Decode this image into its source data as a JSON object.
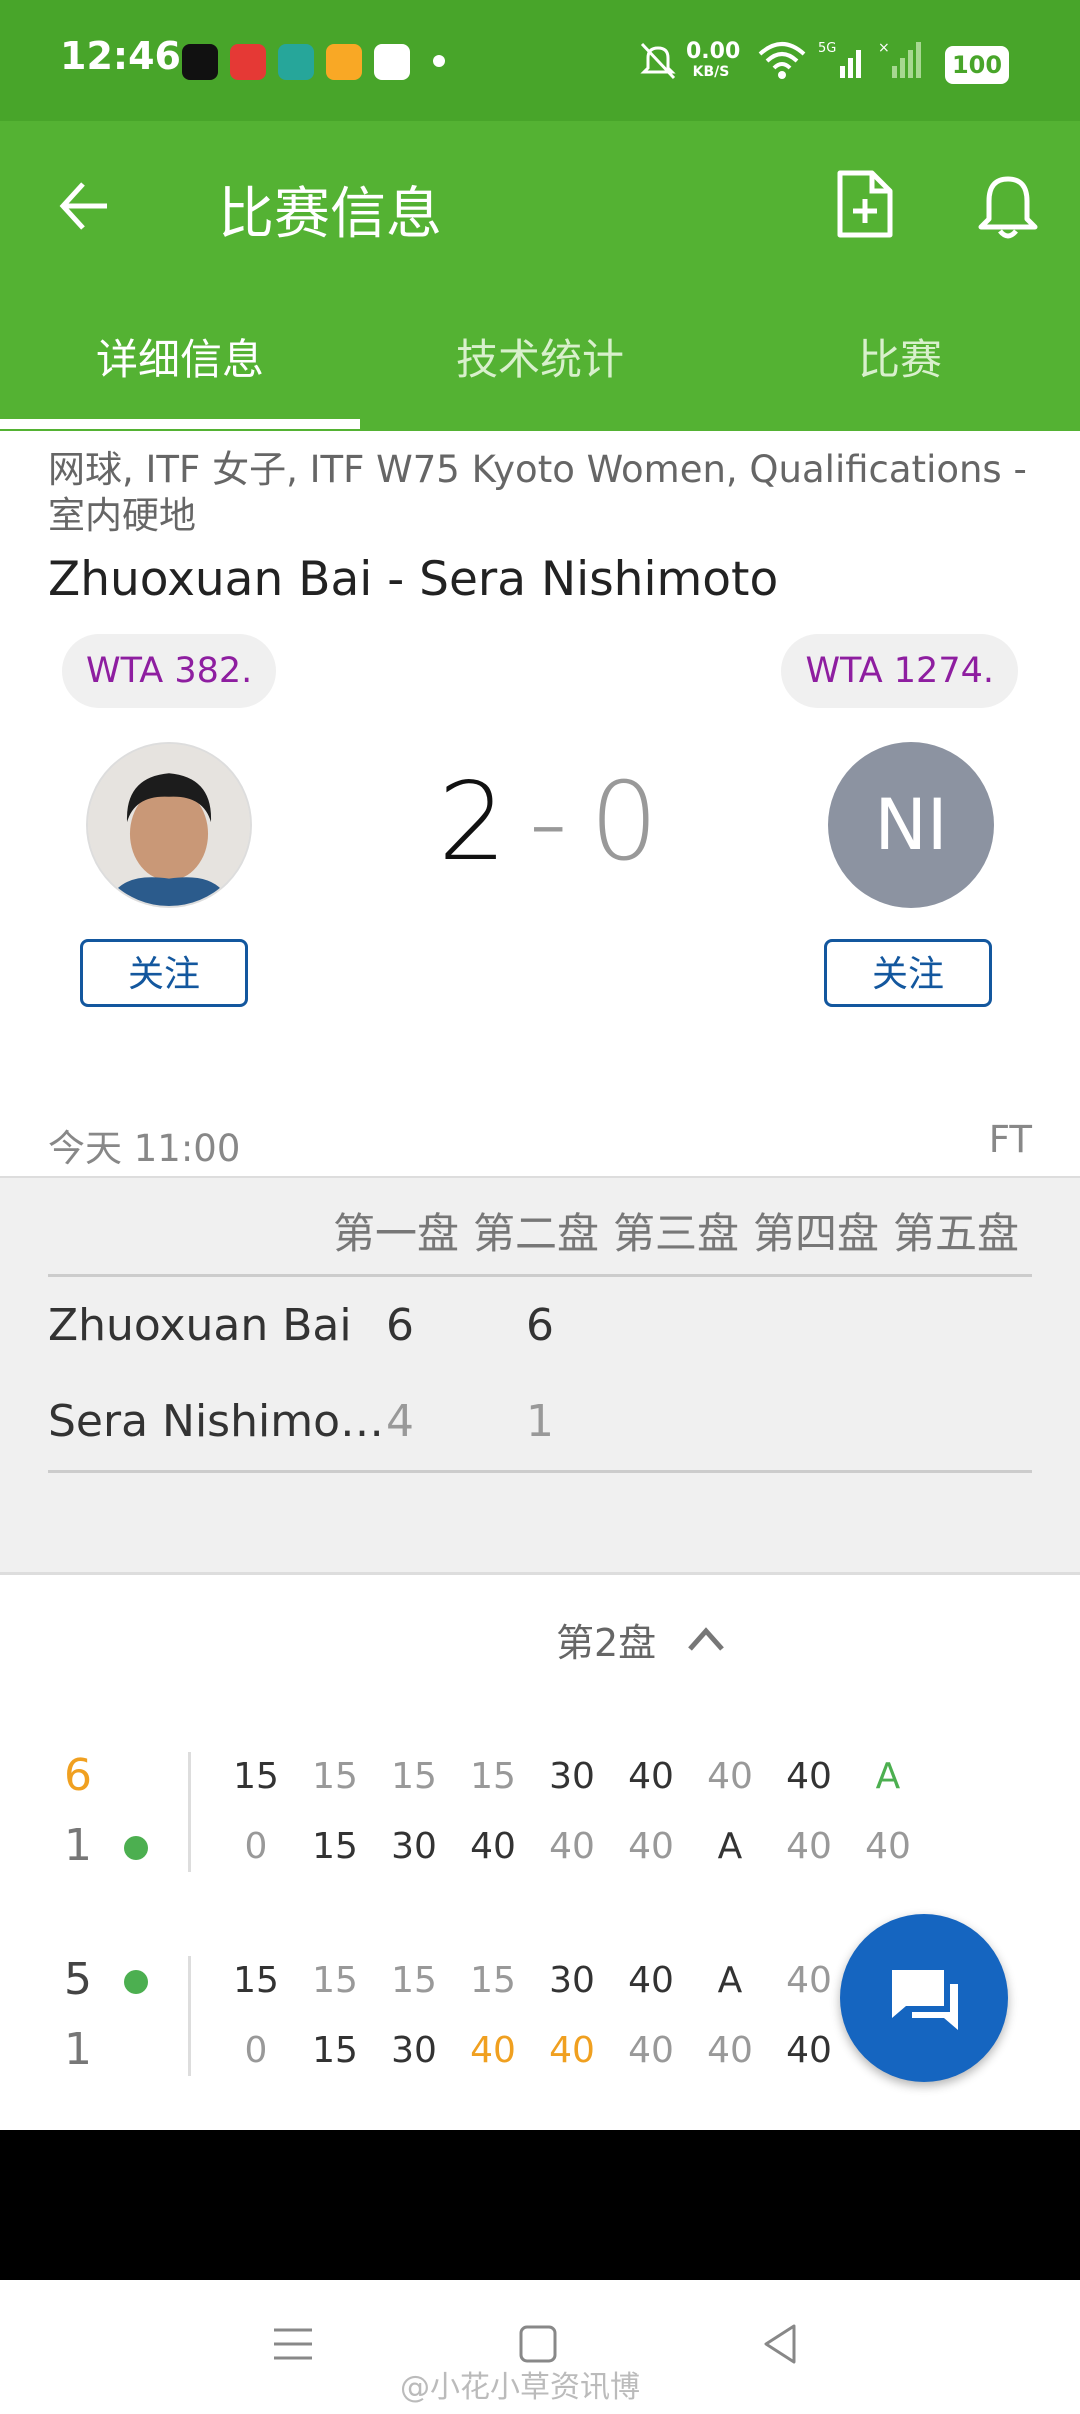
{
  "status": {
    "time": "12:46",
    "net_speed": "0.00",
    "net_unit": "KB/S",
    "signal_label": "5G",
    "battery": "100"
  },
  "header": {
    "title": "比赛信息"
  },
  "tabs": [
    "详细信息",
    "技术统计",
    "比赛"
  ],
  "match": {
    "category": "网球, ITF 女子, ITF W75 Kyoto Women, Qualifications - 室内硬地",
    "title": "Zhuoxuan Bai - Sera Nishimoto",
    "home": {
      "rank": "WTA 382.",
      "follow": "关注"
    },
    "away": {
      "rank": "WTA 1274.",
      "initials": "NI",
      "follow": "关注"
    },
    "score_home": "2",
    "score_sep": "-",
    "score_away": "0",
    "datetime": "今天 11:00",
    "status": "FT"
  },
  "set_table": {
    "headers": [
      "第一盘",
      "第二盘",
      "第三盘",
      "第四盘",
      "第五盘"
    ],
    "rows": [
      {
        "name": "Zhuoxuan Bai",
        "sets": [
          "6",
          "6"
        ]
      },
      {
        "name": "Sera Nishimo…",
        "sets": [
          "4",
          "1"
        ]
      }
    ]
  },
  "set_selector": {
    "label": "第2盘"
  },
  "games": [
    {
      "top": {
        "games": "6",
        "points": [
          "15",
          "15",
          "15",
          "15",
          "30",
          "40",
          "40",
          "40",
          "A"
        ]
      },
      "bottom": {
        "games": "1",
        "points": [
          "0",
          "15",
          "30",
          "40",
          "40",
          "40",
          "A",
          "40",
          "40"
        ]
      }
    },
    {
      "top": {
        "games": "5",
        "points": [
          "15",
          "15",
          "15",
          "15",
          "30",
          "40",
          "A",
          "40"
        ]
      },
      "bottom": {
        "games": "1",
        "points": [
          "0",
          "15",
          "30",
          "40",
          "40",
          "40",
          "40",
          "40"
        ]
      }
    }
  ],
  "colors": {
    "green_dark": "#48a52a",
    "green": "#54b233",
    "rank_purple": "#8e1ea0",
    "follow_blue": "#13579e",
    "fab_blue": "#1565c0",
    "highlight_orange": "#f0a020",
    "win_green": "#4caf50"
  },
  "watermark": "@小花小草资讯博"
}
